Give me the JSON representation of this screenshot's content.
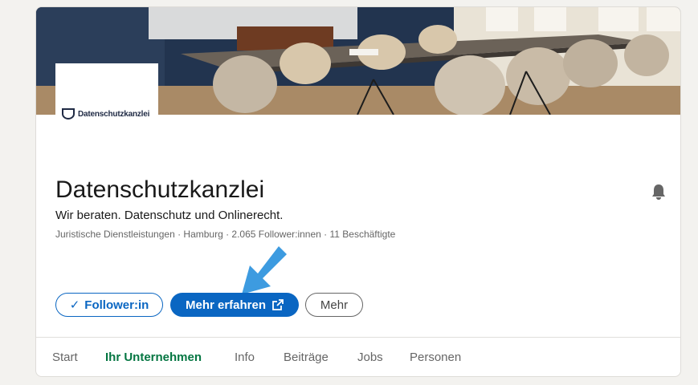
{
  "company": {
    "logo_text": "Datenschutzkanzlei",
    "name": "Datenschutzkanzlei",
    "tagline": "Wir beraten. Datenschutz und Onlinerecht.",
    "meta": "Juristische Dienstleistungen · Hamburg · 2.065 Follower:innen · 11 Beschäftigte"
  },
  "actions": {
    "follow_label": "Follower:in",
    "follow_check": "✓",
    "learn_more_label": "Mehr erfahren",
    "more_label": "Mehr"
  },
  "tabs": [
    {
      "label": "Start",
      "active": false
    },
    {
      "label": "Ihr Unternehmen",
      "active": true
    },
    {
      "label": "Info",
      "active": false
    },
    {
      "label": "Beiträge",
      "active": false
    },
    {
      "label": "Jobs",
      "active": false
    },
    {
      "label": "Personen",
      "active": false
    }
  ],
  "icons": {
    "notification": "bell-icon",
    "external_link": "external-link-icon",
    "annotation": "arrow-icon"
  },
  "colors": {
    "primary": "#0a66c2",
    "active_tab": "#057642",
    "annotation_arrow": "#3d9be0"
  }
}
